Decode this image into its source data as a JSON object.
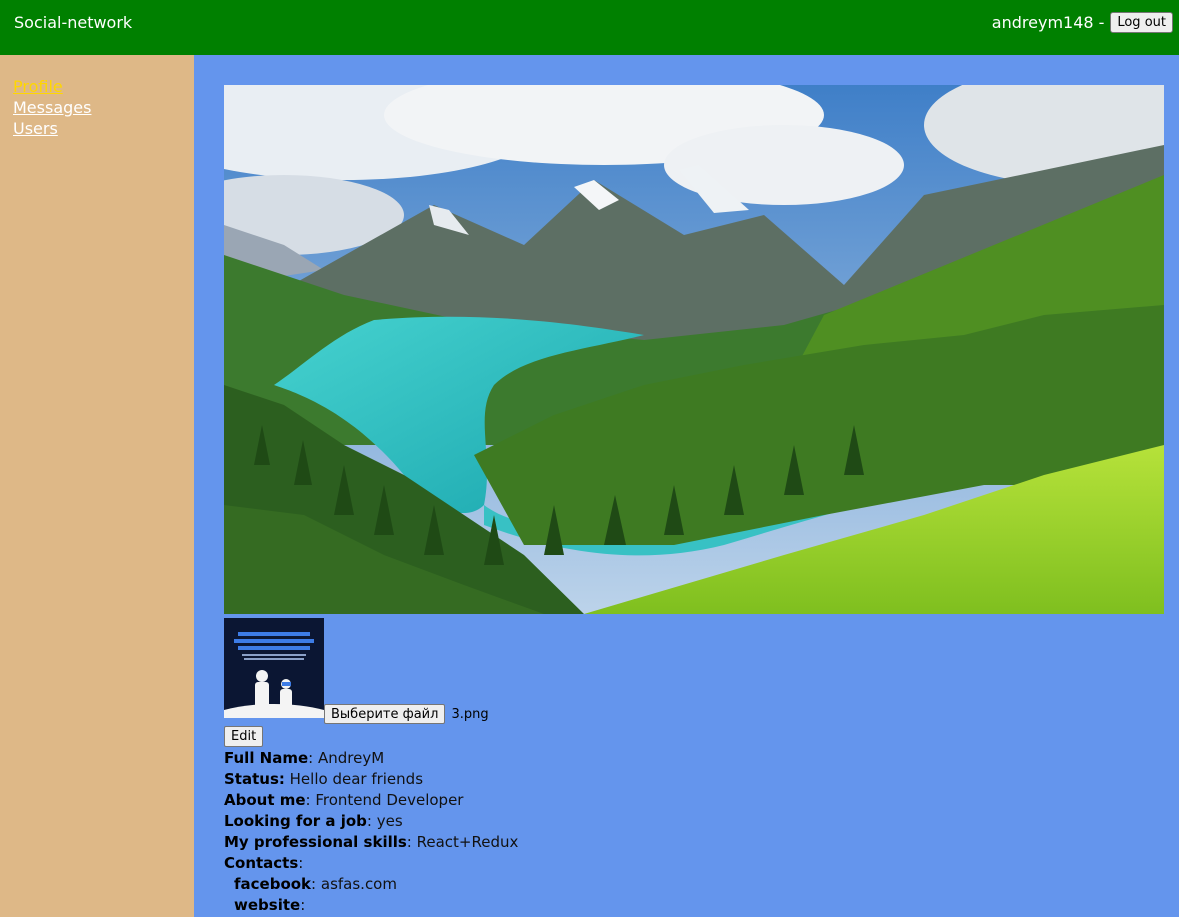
{
  "header": {
    "brand": "Social-network",
    "username": "andreym148",
    "separator": "-",
    "logout_label": "Log out"
  },
  "sidebar": {
    "items": [
      {
        "label": "Profile",
        "active": true
      },
      {
        "label": "Messages",
        "active": false
      },
      {
        "label": "Users",
        "active": false
      }
    ]
  },
  "profile": {
    "hero_image": "mountain-lake-landscape",
    "avatar_image": "help-kids-create-routine-poster",
    "file_button_label": "Выберите файл",
    "file_name": "3.png",
    "edit_label": "Edit",
    "fields": [
      {
        "label": "Full Name",
        "value": "AndreyM"
      },
      {
        "label": "Status:",
        "value": "Hello dear friends"
      },
      {
        "label": "About me",
        "value": "Frontend Developer"
      },
      {
        "label": "Looking for a job",
        "value": "yes"
      },
      {
        "label": "My professional skills",
        "value": "React+Redux"
      },
      {
        "label": "Contacts",
        "value": ""
      }
    ],
    "contacts": [
      {
        "label": "facebook",
        "value": "asfas.com"
      },
      {
        "label": "website",
        "value": ""
      }
    ]
  },
  "colors": {
    "header_bg": "#008000",
    "sidebar_bg": "#deb887",
    "content_bg": "#6495ed",
    "active_link": "#ffd700"
  }
}
